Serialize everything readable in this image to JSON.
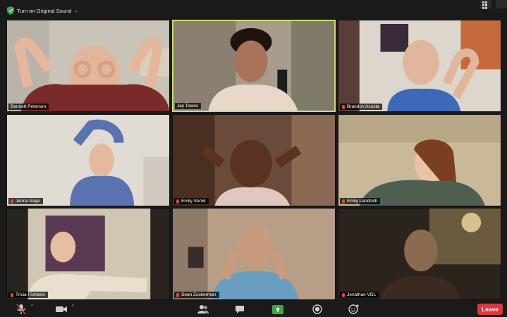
{
  "topbar": {
    "audio_button_label": "Turn on Original Sound",
    "audio_button_chevron": "⌄"
  },
  "participants": [
    {
      "name": "Bennett Petersen",
      "muted": true
    },
    {
      "name": "Jay Towns",
      "muted": false,
      "active_speaker": true
    },
    {
      "name": "Brandon Acosta",
      "muted": true
    },
    {
      "name": "Jenna Sage",
      "muted": true
    },
    {
      "name": "Emily Somé",
      "muted": true
    },
    {
      "name": "Emily Landreth",
      "muted": true
    },
    {
      "name": "Tricia Fishbein",
      "muted": true
    },
    {
      "name": "Sean Zuckerman",
      "muted": true
    },
    {
      "name": "Jonathan VDL",
      "muted": true
    }
  ],
  "toolbar": {
    "caret": "^",
    "leave_label": "Leave",
    "icons": [
      "mute-mic-icon",
      "video-camera-icon",
      "participants-icon",
      "chat-icon",
      "share-screen-icon",
      "record-icon",
      "reactions-icon"
    ]
  },
  "colors": {
    "active_speaker_border": "#c8e06a",
    "leave_button": "#d9363e",
    "share_screen": "#3da64a",
    "muted_indicator": "#d94a4a"
  }
}
